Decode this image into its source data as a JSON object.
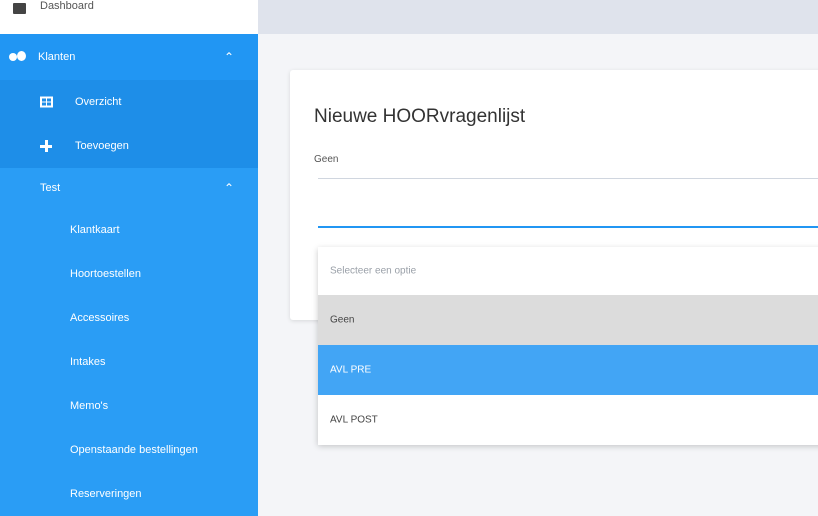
{
  "sidebar": {
    "dashboard": "Dashboard",
    "klanten": "Klanten",
    "overzicht": "Overzicht",
    "toevoegen": "Toevoegen",
    "test": "Test",
    "sub_items": [
      "Klantkaart",
      "Hoortoestellen",
      "Accessoires",
      "Intakes",
      "Memo's",
      "Openstaande bestellingen",
      "Reserveringen"
    ],
    "chevron": "⌃"
  },
  "card": {
    "title": "Nieuwe HOORvragenlijst",
    "select_label": "Geen"
  },
  "dropdown": {
    "placeholder": "Selecteer een optie",
    "options": [
      "Geen",
      "AVL PRE",
      "AVL POST"
    ],
    "highlighted": "AVL PRE"
  },
  "colors": {
    "accent": "#2196f3",
    "highlight": "#42a5f5"
  }
}
